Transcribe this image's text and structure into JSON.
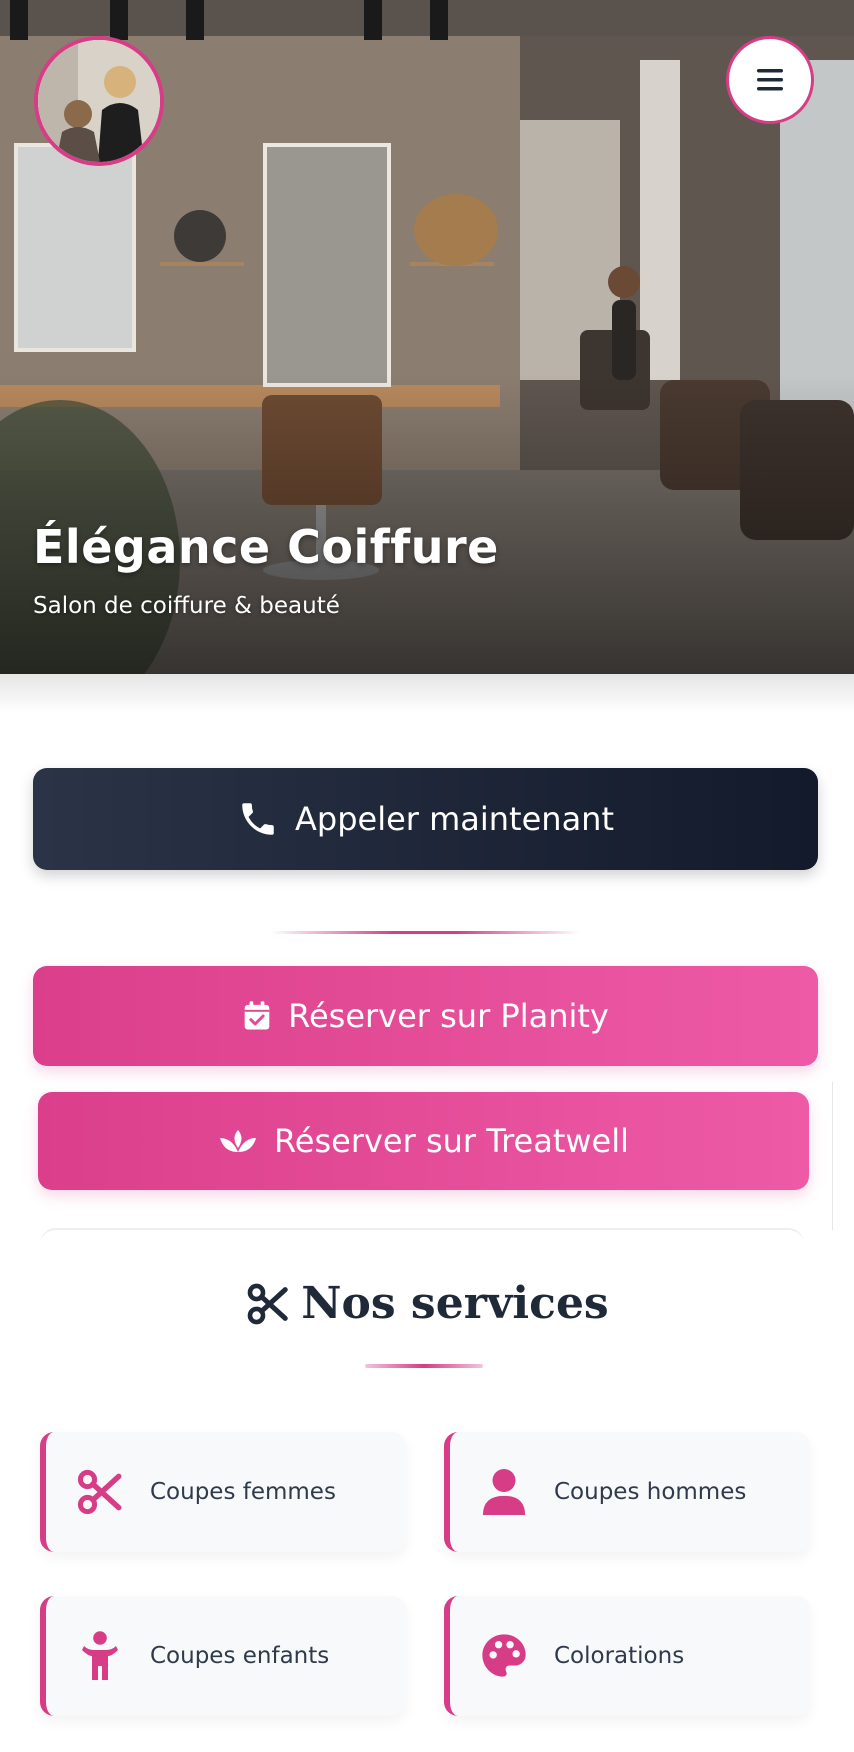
{
  "hero": {
    "title": "Élégance Coiffure",
    "subtitle": "Salon de coiffure & beauté"
  },
  "actions": {
    "call_label": "Appeler maintenant",
    "planity_label": "Réserver sur Planity",
    "treatwell_label": "Réserver sur Treatwell"
  },
  "services": {
    "title": "Nos services",
    "items": [
      {
        "label": "Coupes femmes",
        "icon": "scissors-icon"
      },
      {
        "label": "Coupes hommes",
        "icon": "user-icon"
      },
      {
        "label": "Coupes enfants",
        "icon": "child-icon"
      },
      {
        "label": "Colorations",
        "icon": "palette-icon"
      }
    ]
  },
  "colors": {
    "accent": "#d63d86",
    "dark": "#1f2937",
    "call_button": "#1a2234"
  }
}
